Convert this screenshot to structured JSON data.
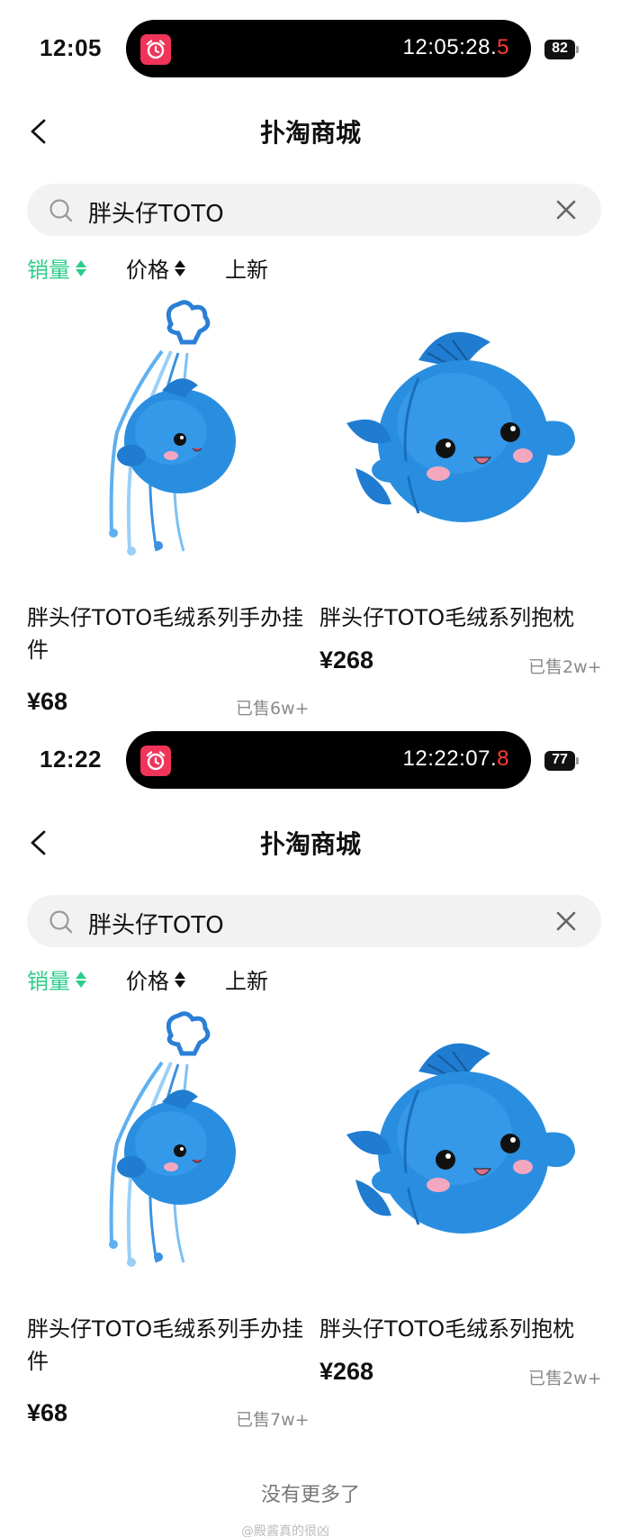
{
  "screens": [
    {
      "status": {
        "clock": "12:05",
        "island_time": "12:05:28.",
        "island_tenth": "5",
        "battery": "82"
      },
      "header": {
        "title": "扑淘商城"
      },
      "search": {
        "query": "胖头仔TOTO"
      },
      "sort": [
        "销量",
        "价格",
        "上新"
      ],
      "products": [
        {
          "name": "胖头仔TOTO毛绒系列手办挂件",
          "price": "¥68",
          "sold": "已售6w+",
          "icon": "fish-keychain-image"
        },
        {
          "name": "胖头仔TOTO毛绒系列抱枕",
          "price": "¥268",
          "sold": "已售2w+",
          "icon": "fish-pillow-image"
        }
      ]
    },
    {
      "status": {
        "clock": "12:22",
        "island_time": "12:22:07.",
        "island_tenth": "8",
        "battery": "77"
      },
      "header": {
        "title": "扑淘商城"
      },
      "search": {
        "query": "胖头仔TOTO"
      },
      "sort": [
        "销量",
        "价格",
        "上新"
      ],
      "products": [
        {
          "name": "胖头仔TOTO毛绒系列手办挂件",
          "price": "¥68",
          "sold": "已售7w+",
          "icon": "fish-keychain-image"
        },
        {
          "name": "胖头仔TOTO毛绒系列抱枕",
          "price": "¥268",
          "sold": "已售2w+",
          "icon": "fish-pillow-image"
        }
      ]
    }
  ],
  "footer": {
    "no_more": "没有更多了"
  },
  "watermark": "@殿酱真的很凶",
  "colors": {
    "accent": "#2ecc8a",
    "alarm": "#f0345a",
    "plush_blue": "#2a8ee0"
  }
}
